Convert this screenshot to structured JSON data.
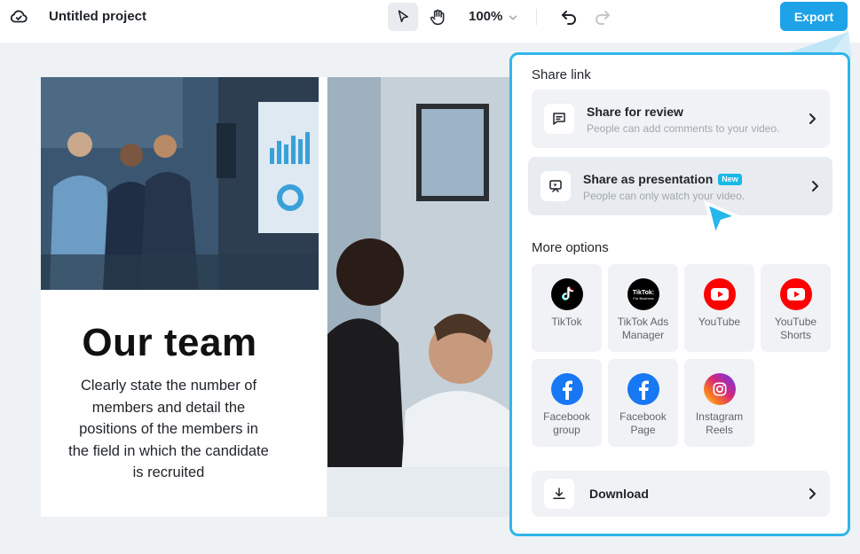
{
  "topbar": {
    "project_title": "Untitled project",
    "zoom_level": "100%",
    "export_label": "Export"
  },
  "slide": {
    "title": "Our team",
    "body": "Clearly state the number of members and detail the positions of the members in the field in which the candidate is recruited"
  },
  "share_panel": {
    "share_link_title": "Share link",
    "review": {
      "title": "Share for review",
      "subtitle": "People can add comments to your video."
    },
    "presentation": {
      "title": "Share as presentation",
      "badge": "New",
      "subtitle": "People can only watch your video."
    },
    "more_options_title": "More options",
    "options": [
      {
        "label": "TikTok",
        "icon": "tiktok-icon"
      },
      {
        "label": "TikTok Ads Manager",
        "icon": "tiktok-business-icon",
        "logo_text": "TikTok: For Business"
      },
      {
        "label": "YouTube",
        "icon": "youtube-icon"
      },
      {
        "label": "YouTube Shorts",
        "icon": "youtube-shorts-icon"
      },
      {
        "label": "Facebook group",
        "icon": "facebook-icon"
      },
      {
        "label": "Facebook Page",
        "icon": "facebook-icon"
      },
      {
        "label": "Instagram Reels",
        "icon": "instagram-icon"
      }
    ],
    "download_label": "Download"
  },
  "colors": {
    "accent": "#1ea3e8",
    "panel_border": "#2fb6ea",
    "badge": "#18b9e6",
    "youtube_red": "#ff0000",
    "facebook_blue": "#1877f2"
  }
}
